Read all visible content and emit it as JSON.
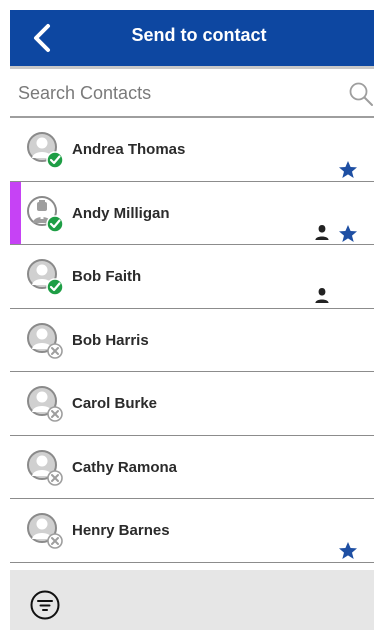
{
  "header": {
    "title": "Send to contact",
    "back_icon": "chevron-left-icon",
    "background": "#0d47a1"
  },
  "search": {
    "placeholder": "Search Contacts",
    "value": "",
    "icon": "search-icon"
  },
  "contacts": [
    {
      "name": "Andrea Thomas",
      "status": "online",
      "avatar": "generic",
      "favorite": true,
      "user_type": false,
      "selected": false
    },
    {
      "name": "Andy Milligan",
      "status": "online",
      "avatar": "dispatcher",
      "favorite": true,
      "user_type": true,
      "selected": true
    },
    {
      "name": "Bob Faith",
      "status": "online",
      "avatar": "generic",
      "favorite": false,
      "user_type": true,
      "selected": false
    },
    {
      "name": "Bob Harris",
      "status": "offline",
      "avatar": "generic",
      "favorite": false,
      "user_type": false,
      "selected": false
    },
    {
      "name": "Carol Burke",
      "status": "offline",
      "avatar": "generic",
      "favorite": false,
      "user_type": false,
      "selected": false
    },
    {
      "name": "Cathy Ramona",
      "status": "offline",
      "avatar": "generic",
      "favorite": false,
      "user_type": false,
      "selected": false
    },
    {
      "name": "Henry Barnes",
      "status": "offline",
      "avatar": "generic",
      "favorite": true,
      "user_type": false,
      "selected": false
    }
  ],
  "colors": {
    "online": "#1e9e45",
    "offline": "#9e9e9e",
    "favorite": "#1e4fa3",
    "selected_marker": "#c642f5"
  },
  "footer": {
    "filter_icon": "filter-icon"
  }
}
